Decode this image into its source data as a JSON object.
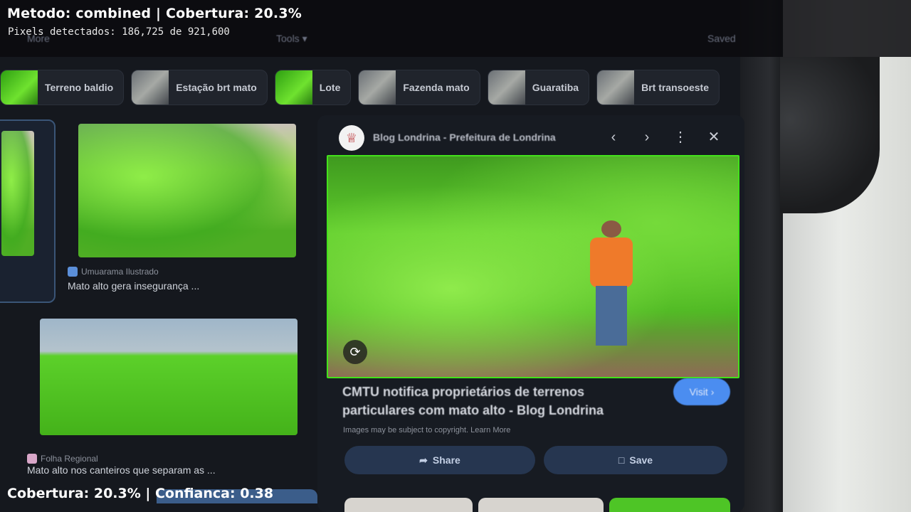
{
  "overlay": {
    "method_line": "Metodo: combined | Cobertura: 20.3%",
    "pixels_line": "Pixels detectados: 186,725 de 921,600",
    "coverage_line": "Cobertura: 20.3% | Confianca: 0.38"
  },
  "toolbar": {
    "more_label": "More",
    "tools_label": "Tools ▾",
    "saved_label": "Saved"
  },
  "chips": [
    {
      "label": "Terreno baldio"
    },
    {
      "label": "Estação brt mato"
    },
    {
      "label": "Lote"
    },
    {
      "label": "Fazenda mato"
    },
    {
      "label": "Guaratiba"
    },
    {
      "label": "Brt transoeste"
    }
  ],
  "results": [
    {
      "source": "Umuarama Ilustrado",
      "title": "Mato alto gera insegurança ..."
    },
    {
      "source": "Folha Regional",
      "title": "Mato alto nos canteiros que separam as ..."
    }
  ],
  "detail": {
    "source": "Blog Londrina - Prefeitura de Londrina",
    "title": "CMTU notifica proprietários de terrenos particulares com mato alto - Blog Londrina",
    "visit_label": "Visit ›",
    "copyright": "Images may be subject to copyright. Learn More",
    "share_label": "Share",
    "save_label": "Save"
  },
  "colors": {
    "detection_green": "#43e21b",
    "visit_button": "#4b8df0"
  }
}
